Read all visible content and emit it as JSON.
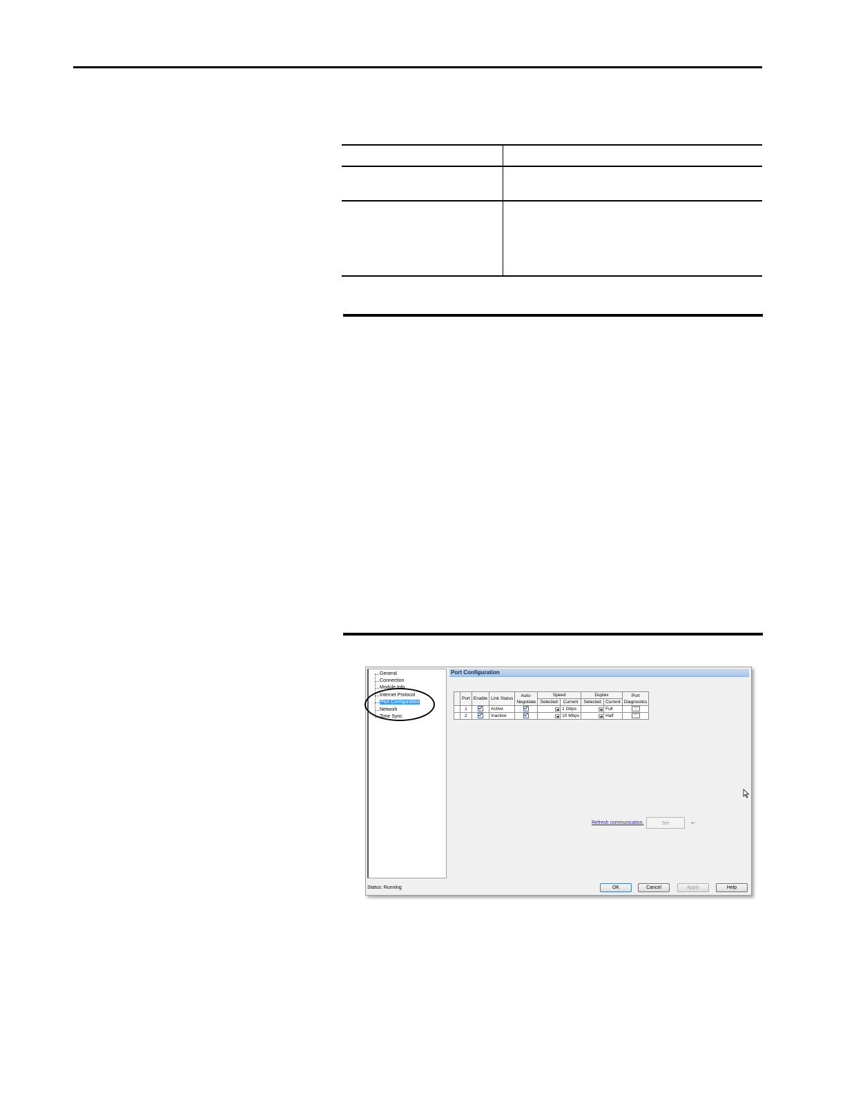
{
  "dialog": {
    "tree_items": [
      {
        "label": "General"
      },
      {
        "label": "Connection"
      },
      {
        "label": "Module Info"
      },
      {
        "label": "Internet Protocol"
      },
      {
        "label": "Port Configuration"
      },
      {
        "label": "Network"
      },
      {
        "label": "Time Sync"
      }
    ],
    "section_title": "Port Configuration",
    "grid": {
      "headers": {
        "port": "Port",
        "enable": "Enable",
        "link_status": "Link Status",
        "auto_negotiate": "Auto-\nNegotiate",
        "speed": "Speed",
        "duplex": "Duplex",
        "port_diagnostics": "Port\nDiagnostics",
        "selected": "Selected",
        "current": "Current"
      },
      "rows": [
        {
          "port": "1",
          "link_status": "Active",
          "speed_current": "1 Gbps",
          "duplex_current": "Full",
          "diag": "..."
        },
        {
          "port": "2",
          "link_status": "Inactive",
          "speed_current": "10 Mbps",
          "duplex_current": "Half",
          "diag": "..."
        }
      ]
    },
    "refresh_link": "Refresh communication.",
    "set_button": "Set",
    "status_label": "Status:  Running",
    "buttons": {
      "ok": "OK",
      "cancel": "Cancel",
      "apply": "Apply",
      "help": "Help"
    },
    "icons": {
      "set_arrow": "left-arrow-icon",
      "cursor": "mouse-pointer-icon"
    }
  }
}
